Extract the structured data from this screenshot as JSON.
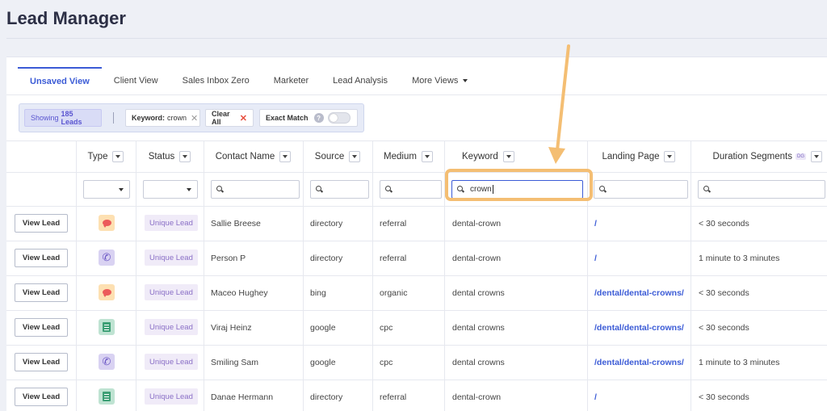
{
  "page": {
    "title": "Lead Manager"
  },
  "tabs": [
    {
      "label": "Unsaved View",
      "active": true
    },
    {
      "label": "Client View"
    },
    {
      "label": "Sales Inbox Zero"
    },
    {
      "label": "Marketer"
    },
    {
      "label": "Lead Analysis"
    },
    {
      "label": "More Views"
    }
  ],
  "filters": {
    "showing_prefix": "Showing",
    "showing_count": "185 Leads",
    "keyword_label": "Keyword:",
    "keyword_value": "crown",
    "clear_all": "Clear All",
    "exact_match": "Exact Match",
    "help_glyph": "?"
  },
  "columns": {
    "type": "Type",
    "status": "Status",
    "contact": "Contact Name",
    "source": "Source",
    "medium": "Medium",
    "keyword": "Keyword",
    "landing": "Landing Page",
    "duration": "Duration Segments",
    "duration_badge": "DG"
  },
  "column_filters": {
    "keyword_value": "crown"
  },
  "view_lead_label": "View Lead",
  "rows": [
    {
      "type_icon": "chat-icon",
      "status": "Unique Lead",
      "contact": "Sallie Breese",
      "source": "directory",
      "medium": "referral",
      "keyword": "dental-crown",
      "landing": "/",
      "duration": "< 30 seconds"
    },
    {
      "type_icon": "phone-icon",
      "status": "Unique Lead",
      "contact": "Person P",
      "source": "directory",
      "medium": "referral",
      "keyword": "dental-crown",
      "landing": "/",
      "duration": "1 minute to 3 minutes"
    },
    {
      "type_icon": "chat-icon",
      "status": "Unique Lead",
      "contact": "Maceo Hughey",
      "source": "bing",
      "medium": "organic",
      "keyword": "dental crowns",
      "landing": "/dental/dental-crowns/",
      "duration": "< 30 seconds"
    },
    {
      "type_icon": "form-icon",
      "status": "Unique Lead",
      "contact": "Viraj Heinz",
      "source": "google",
      "medium": "cpc",
      "keyword": "dental crowns",
      "landing": "/dental/dental-crowns/",
      "duration": "< 30 seconds"
    },
    {
      "type_icon": "phone-icon",
      "status": "Unique Lead",
      "contact": "Smiling Sam",
      "source": "google",
      "medium": "cpc",
      "keyword": "dental crowns",
      "landing": "/dental/dental-crowns/",
      "duration": "1 minute to 3 minutes"
    },
    {
      "type_icon": "form-icon",
      "status": "Unique Lead",
      "contact": "Danae Hermann",
      "source": "directory",
      "medium": "referral",
      "keyword": "dental-crown",
      "landing": "/",
      "duration": "< 30 seconds"
    }
  ],
  "colors": {
    "accent": "#3b5bd6",
    "highlight": "#f4be73",
    "badge_text": "#8a6fc6"
  }
}
